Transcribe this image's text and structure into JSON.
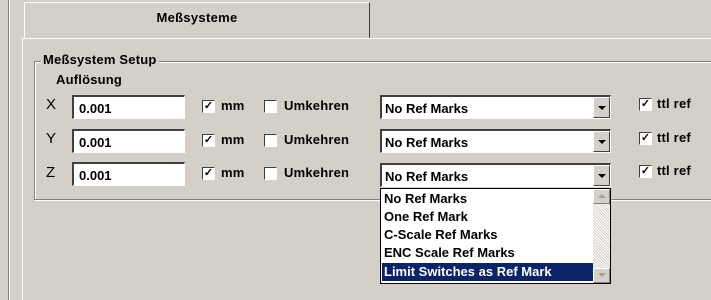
{
  "tab": {
    "title": "Meßsysteme"
  },
  "group": {
    "title": "Meßsystem Setup",
    "resolution_label": "Auflösung"
  },
  "axes": [
    {
      "axis": "X",
      "resolution": "0.001",
      "mm_checked": true,
      "mm_label": "mm",
      "invert_checked": false,
      "invert_label": "Umkehren",
      "ref_mode": "No Ref Marks",
      "ttl_checked": true,
      "ttl_label": "ttl ref"
    },
    {
      "axis": "Y",
      "resolution": "0.001",
      "mm_checked": true,
      "mm_label": "mm",
      "invert_checked": false,
      "invert_label": "Umkehren",
      "ref_mode": "No Ref Marks",
      "ttl_checked": true,
      "ttl_label": "ttl ref"
    },
    {
      "axis": "Z",
      "resolution": "0.001",
      "mm_checked": true,
      "mm_label": "mm",
      "invert_checked": false,
      "invert_label": "Umkehren",
      "ref_mode": "No Ref Marks",
      "ttl_checked": true,
      "ttl_label": "ttl ref"
    }
  ],
  "dropdown": {
    "options": [
      "No Ref Marks",
      "One Ref Mark",
      "C-Scale Ref Marks",
      "ENC Scale Ref Marks",
      "Limit Switches as Ref Mark"
    ],
    "highlighted_index": 4
  },
  "colors": {
    "face": "#d4d0c8",
    "highlight": "#0a246a"
  }
}
